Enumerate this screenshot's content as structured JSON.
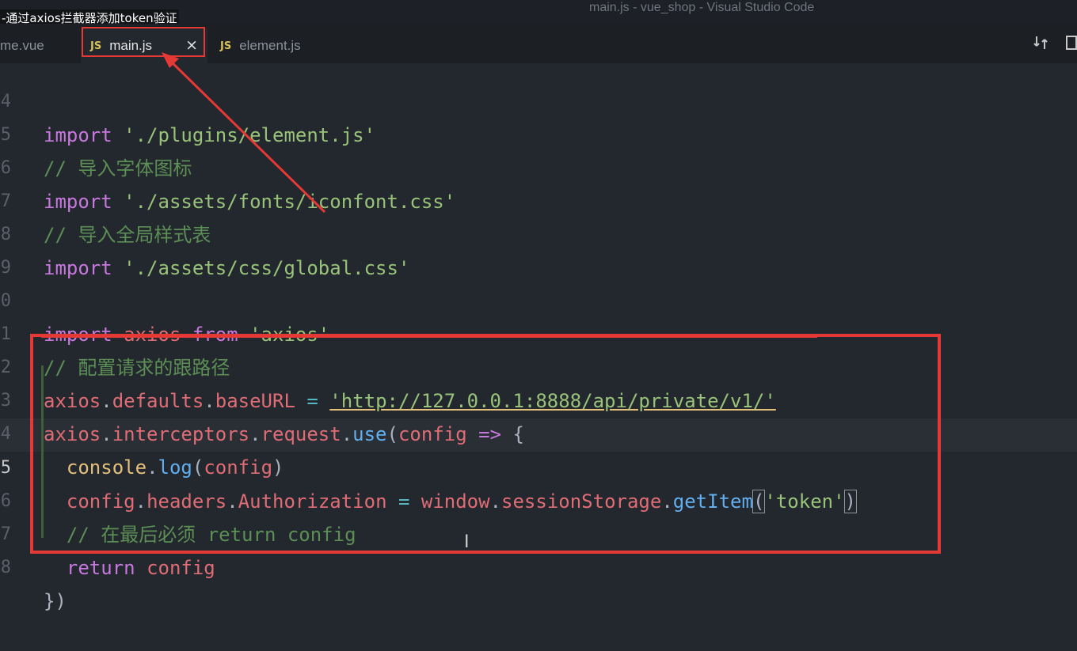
{
  "video_title": "-通过axios拦截器添加token验证",
  "window_title": "main.js - vue_shop - Visual Studio Code",
  "tabs": [
    {
      "label": "me.vue",
      "icon": ""
    },
    {
      "label": "main.js",
      "icon": "JS",
      "close": "×"
    },
    {
      "label": "element.js",
      "icon": "JS"
    }
  ],
  "toolbar": {
    "compare_icon": "compare-changes-icon",
    "split_icon": "split-editor-icon"
  },
  "lines": [
    {
      "n": "4",
      "tokens": [
        "import",
        " ",
        "'./plugins/element.js'"
      ]
    },
    {
      "n": "5",
      "tokens": [
        "// 导入字体图标"
      ]
    },
    {
      "n": "6",
      "tokens": [
        "import",
        " ",
        "'./assets/fonts/iconfont.css'"
      ]
    },
    {
      "n": "7",
      "tokens": [
        "// 导入全局样式表"
      ]
    },
    {
      "n": "8",
      "tokens": [
        "import",
        " ",
        "'./assets/css/global.css'"
      ]
    },
    {
      "n": "9",
      "tokens": []
    },
    {
      "n": "0",
      "tokens": [
        "import",
        " ",
        "axios",
        " ",
        "from",
        " ",
        "'axios'"
      ]
    },
    {
      "n": "1",
      "tokens": [
        "// 配置请求的跟路径"
      ]
    },
    {
      "n": "2",
      "tokens": [
        "axios",
        ".",
        "defaults",
        ".",
        "baseURL",
        " = ",
        "'http://127.0.0.1:8888/api/private/v1/'"
      ]
    },
    {
      "n": "3",
      "tokens": [
        "axios",
        ".",
        "interceptors",
        ".",
        "request",
        ".",
        "use",
        "(",
        "config",
        " ",
        "=>",
        " {"
      ]
    },
    {
      "n": "4",
      "tokens": [
        "  ",
        "console",
        ".",
        "log",
        "(",
        "config",
        ")"
      ]
    },
    {
      "n": "5",
      "tokens": [
        "  ",
        "config",
        ".",
        "headers",
        ".",
        "Authorization",
        " = ",
        "window",
        ".",
        "sessionStorage",
        ".",
        "getItem",
        "(",
        "'token'",
        ")"
      ]
    },
    {
      "n": "6",
      "tokens": [
        "  // 在最后必须 return config"
      ]
    },
    {
      "n": "7",
      "tokens": [
        "  ",
        "return",
        " ",
        "config"
      ]
    },
    {
      "n": "8",
      "tokens": [
        "})"
      ]
    }
  ],
  "colors": {
    "highlight_red": "#e53935",
    "editor_bg": "#23272e",
    "keyword": "#c678dd",
    "string": "#98c379",
    "comment": "#5c8f55",
    "variable": "#e06c75",
    "function": "#61afef"
  }
}
